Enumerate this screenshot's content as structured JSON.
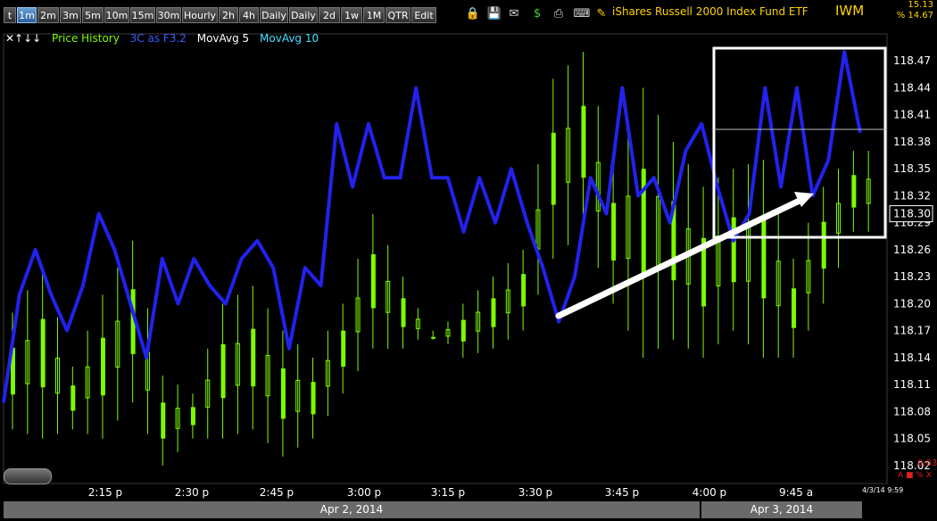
{
  "toolbar": {
    "timeframes": [
      {
        "label": "t",
        "active": false
      },
      {
        "label": "1m",
        "active": true
      },
      {
        "label": "2m",
        "active": false
      },
      {
        "label": "3m",
        "active": false
      },
      {
        "label": "5m",
        "active": false
      },
      {
        "label": "10m",
        "active": false
      },
      {
        "label": "15m",
        "active": false
      },
      {
        "label": "30m",
        "active": false
      },
      {
        "label": "Hourly",
        "active": false
      },
      {
        "label": "2h",
        "active": false
      },
      {
        "label": "4h",
        "active": false
      },
      {
        "label": "Daily",
        "active": false
      },
      {
        "label": "Daily",
        "active": false
      },
      {
        "label": "2d",
        "active": false
      },
      {
        "label": "1w",
        "active": false
      },
      {
        "label": "1M",
        "active": false
      },
      {
        "label": "QTR",
        "active": false
      },
      {
        "label": "Edit",
        "active": false
      }
    ],
    "icons": [
      "lock-icon",
      "save-icon",
      "mail-icon",
      "dollar-icon",
      "print-icon",
      "keyboard-icon",
      "pencil-icon"
    ],
    "title": "iShares Russell 2000 Index Fund ETF",
    "ticker": "IWM",
    "top_value": "15.13",
    "top_pct": "% 14.67"
  },
  "legend": {
    "arrows": "✕↑↓↓",
    "price_history": "Price History",
    "indicator": "3C as F3.2",
    "movavg5": "MovAvg 5",
    "movavg10": "MovAvg 10"
  },
  "price_axis": {
    "labels": [
      "118.47",
      "118.44",
      "118.41",
      "118.38",
      "118.35",
      "118.32",
      "118.29",
      "118.26",
      "118.23",
      "118.20",
      "118.17",
      "118.14",
      "118.11",
      "118.08",
      "118.05",
      "118.02"
    ],
    "current_price": "118.30"
  },
  "time_axis": {
    "labels": [
      "2:15 p",
      "2:30 p",
      "2:45 p",
      "3:00 p",
      "3:15 p",
      "3:30 p",
      "3:45 p",
      "4:00 p",
      "9:45 a"
    ]
  },
  "date_bar": {
    "dates": [
      "Apr 2, 2014",
      "Apr 3, 2014"
    ]
  },
  "footer": {
    "timestamp": "4/3/14 9:59",
    "small_value": "0.03",
    "ax_label": "A ■ % X"
  },
  "colors": {
    "candle": "#7cfc00",
    "indicator_line": "#2222ee",
    "accent": "#ffd400"
  },
  "chart_data": {
    "type": "line",
    "series": [
      {
        "name": "3C as F3.2",
        "values": [
          118.09,
          118.21,
          118.26,
          118.21,
          118.17,
          118.22,
          118.3,
          118.26,
          118.2,
          118.14,
          118.25,
          118.2,
          118.25,
          118.22,
          118.2,
          118.25,
          118.27,
          118.24,
          118.15,
          118.24,
          118.22,
          118.4,
          118.33,
          118.4,
          118.34,
          118.34,
          118.44,
          118.34,
          118.34,
          118.28,
          118.34,
          118.29,
          118.35,
          118.29,
          118.24,
          118.18,
          118.23,
          118.34,
          118.3,
          118.44,
          118.32,
          118.34,
          118.29,
          118.37,
          118.4,
          118.33,
          118.27,
          118.3,
          118.44,
          118.33,
          118.44,
          118.32,
          118.36,
          118.48,
          118.39
        ]
      },
      {
        "name": "Price High",
        "values": [
          118.19,
          118.24,
          118.13,
          118.21,
          118.27,
          118.12,
          118.1,
          118.2,
          118.22,
          118.17,
          118.14,
          118.2,
          118.3,
          118.23,
          118.16,
          118.2,
          118.23,
          118.26,
          118.45,
          118.48,
          118.36,
          118.44,
          118.38,
          118.33,
          118.35,
          118.36,
          118.25,
          118.33,
          118.37
        ]
      },
      {
        "name": "Price Low",
        "values": [
          118.06,
          118.05,
          118.06,
          118.05,
          118.09,
          118.02,
          118.05,
          118.05,
          118.06,
          118.03,
          118.05,
          118.1,
          118.15,
          118.15,
          118.17,
          118.14,
          118.15,
          118.17,
          118.25,
          118.28,
          118.2,
          118.14,
          118.16,
          118.14,
          118.17,
          118.14,
          118.14,
          118.2,
          118.28
        ]
      }
    ],
    "ylim": [
      118.0,
      118.5
    ],
    "xlabel": "",
    "ylabel": "",
    "annotations": [
      "white-trend-arrow",
      "white-highlight-box"
    ]
  }
}
